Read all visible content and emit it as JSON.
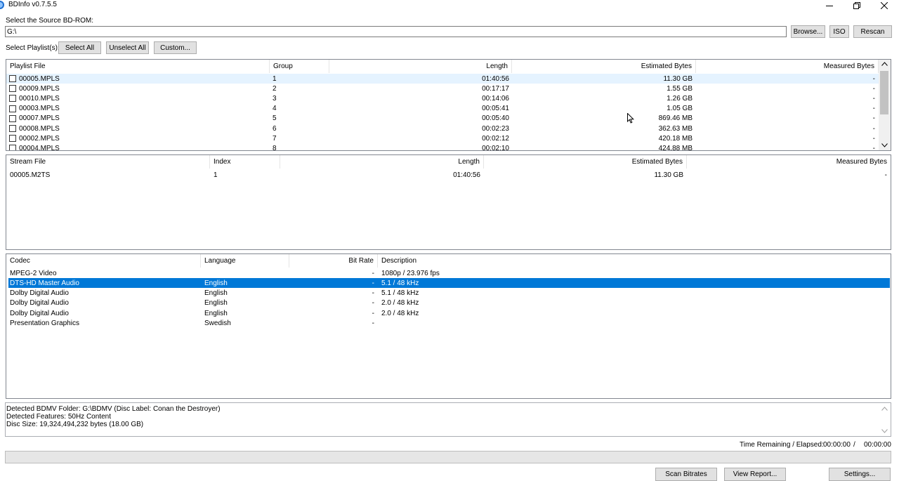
{
  "window": {
    "title": "BDInfo v0.7.5.5"
  },
  "source": {
    "label": "Select the Source BD-ROM:",
    "path_value": "G:\\",
    "browse_label": "Browse...",
    "iso_label": "ISO",
    "rescan_label": "Rescan"
  },
  "playlist_select": {
    "label": "Select Playlist(s):",
    "select_all_label": "Select All",
    "unselect_all_label": "Unselect All",
    "custom_label": "Custom..."
  },
  "playlists": {
    "columns": [
      "Playlist File",
      "Group",
      "Length",
      "Estimated Bytes",
      "Measured Bytes"
    ],
    "rows": [
      {
        "file": "00005.MPLS",
        "group": "1",
        "length": "01:40:56",
        "est": "11.30 GB",
        "meas": "-"
      },
      {
        "file": "00009.MPLS",
        "group": "2",
        "length": "00:17:17",
        "est": "1.55 GB",
        "meas": "-"
      },
      {
        "file": "00010.MPLS",
        "group": "3",
        "length": "00:14:06",
        "est": "1.26 GB",
        "meas": "-"
      },
      {
        "file": "00003.MPLS",
        "group": "4",
        "length": "00:05:41",
        "est": "1.05 GB",
        "meas": "-"
      },
      {
        "file": "00007.MPLS",
        "group": "5",
        "length": "00:05:40",
        "est": "869.46 MB",
        "meas": "-"
      },
      {
        "file": "00008.MPLS",
        "group": "6",
        "length": "00:02:23",
        "est": "362.63 MB",
        "meas": "-"
      },
      {
        "file": "00002.MPLS",
        "group": "7",
        "length": "00:02:12",
        "est": "420.18 MB",
        "meas": "-"
      },
      {
        "file": "00004.MPLS",
        "group": "8",
        "length": "00:02:10",
        "est": "424.88 MB",
        "meas": "-"
      }
    ]
  },
  "streams": {
    "columns": [
      "Stream File",
      "Index",
      "Length",
      "Estimated Bytes",
      "Measured Bytes"
    ],
    "rows": [
      {
        "file": "00005.M2TS",
        "index": "1",
        "length": "01:40:56",
        "est": "11.30 GB",
        "meas": "-"
      }
    ]
  },
  "codecs": {
    "columns": [
      "Codec",
      "Language",
      "Bit Rate",
      "Description"
    ],
    "rows": [
      {
        "codec": "MPEG-2 Video",
        "language": "",
        "bitrate": "-",
        "desc": "1080p / 23.976 fps"
      },
      {
        "codec": "DTS-HD Master Audio",
        "language": "English",
        "bitrate": "-",
        "desc": "5.1 / 48 kHz"
      },
      {
        "codec": "Dolby Digital Audio",
        "language": "English",
        "bitrate": "-",
        "desc": "5.1 / 48 kHz"
      },
      {
        "codec": "Dolby Digital Audio",
        "language": "English",
        "bitrate": "-",
        "desc": "2.0 / 48 kHz"
      },
      {
        "codec": "Dolby Digital Audio",
        "language": "English",
        "bitrate": "-",
        "desc": "2.0 / 48 kHz"
      },
      {
        "codec": "Presentation Graphics",
        "language": "Swedish",
        "bitrate": "-",
        "desc": ""
      }
    ],
    "selected_index": 1
  },
  "info": {
    "lines": [
      "Detected BDMV Folder: G:\\BDMV (Disc Label: Conan the Destroyer)",
      "Detected Features: 50Hz Content",
      "Disc Size: 19,324,494,232 bytes (18.00 GB)"
    ]
  },
  "status": {
    "time_label": "Time Remaining / Elapsed:",
    "remaining": "00:00:00",
    "separator": "/",
    "elapsed": "00:00:00",
    "progress_fraction": 0
  },
  "footer": {
    "scan_label": "Scan Bitrates",
    "report_label": "View Report...",
    "settings_label": "Settings..."
  },
  "icons": [
    "app-icon",
    "minimize-icon",
    "restore-icon",
    "close-icon",
    "scroll-up-icon",
    "scroll-down-icon",
    "cursor-icon"
  ]
}
